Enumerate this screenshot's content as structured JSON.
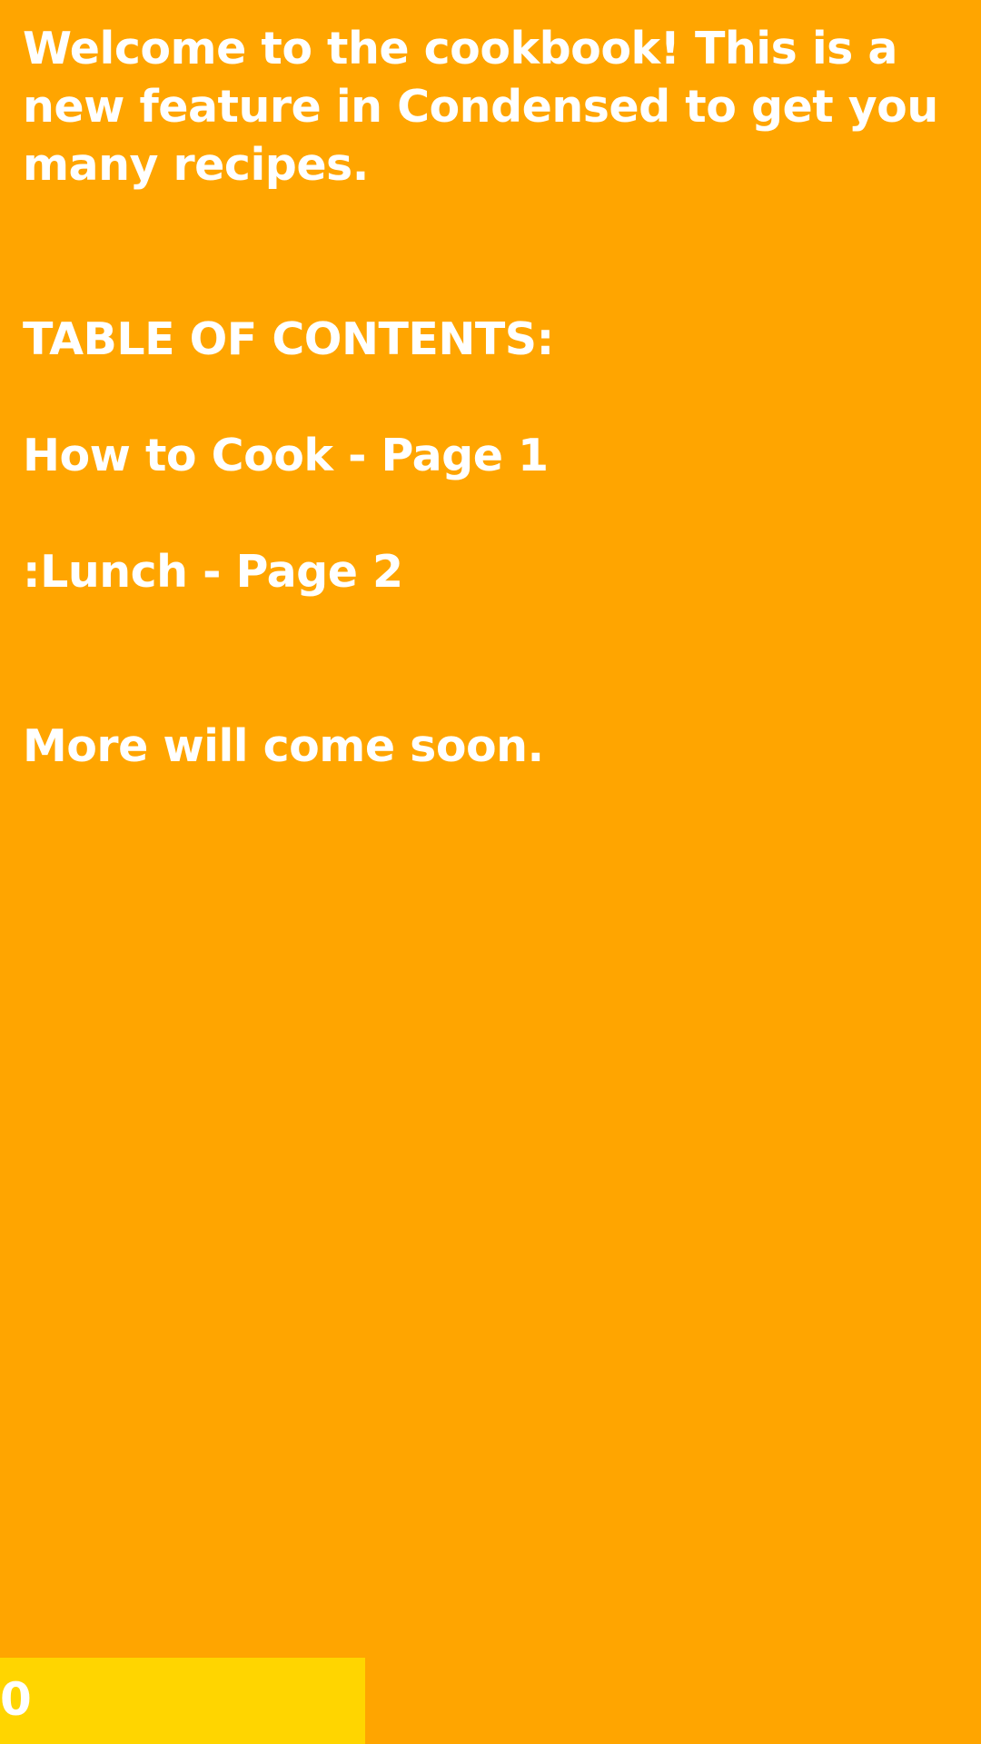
{
  "colors": {
    "background": "#FFA500",
    "text": "#FFFFFF",
    "counter_background": "#FFD500"
  },
  "intro": {
    "text": "Welcome to the cookbook! This is a new feature in Condensed to get you many recipes."
  },
  "toc": {
    "heading": "TABLE OF CONTENTS:",
    "items": [
      {
        "label": "How to Cook - Page 1"
      },
      {
        "label": ":Lunch - Page 2"
      }
    ],
    "footer_note": "More will come soon."
  },
  "page_counter": {
    "value": "0"
  }
}
